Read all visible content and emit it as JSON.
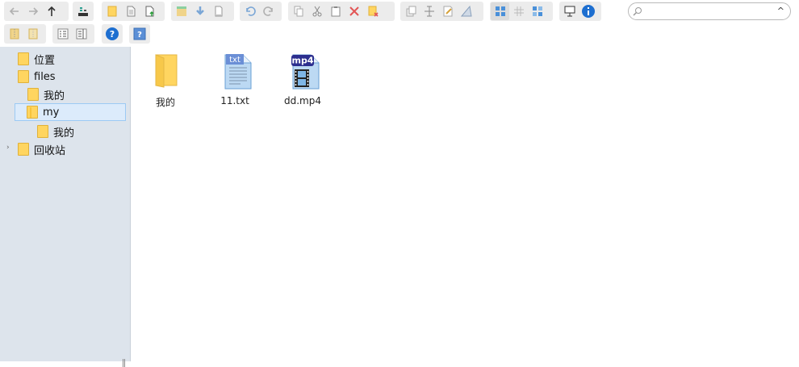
{
  "toolbar": {
    "search_placeholder": "",
    "search_caret": "^"
  },
  "sidebar": {
    "items": [
      {
        "label": "位置"
      },
      {
        "label": "files"
      },
      {
        "label": "我的"
      },
      {
        "label": "my"
      },
      {
        "label": "我的"
      },
      {
        "label": "回收站"
      }
    ],
    "expander": "›"
  },
  "content": {
    "files": [
      {
        "name": "我的",
        "type": "folder"
      },
      {
        "name": "11.txt",
        "type": "txt",
        "badge": "txt"
      },
      {
        "name": "dd.mp4",
        "type": "mp4",
        "badge": "mp4"
      }
    ]
  },
  "colors": {
    "accent_blue": "#1e6fd0",
    "folder_yellow": "#ffd560",
    "selection_bg": "#dcebfb",
    "sidebar_bg": "#dde4ec",
    "mp4_badge": "#2c2f8f",
    "txt_badge": "#6b8fd6"
  }
}
